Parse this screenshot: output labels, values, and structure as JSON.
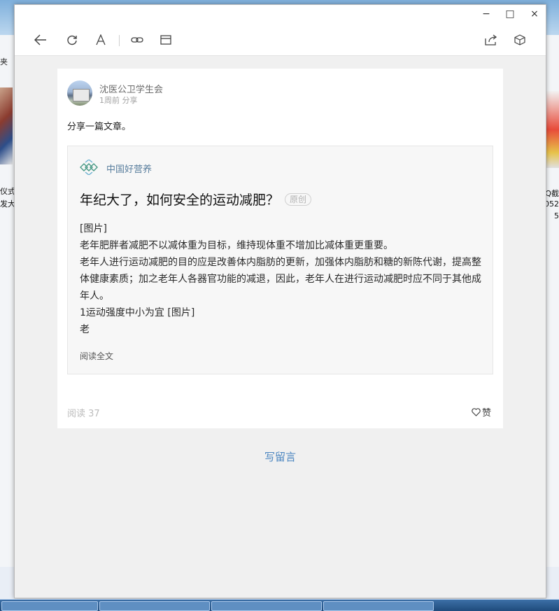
{
  "desktop": {
    "left_top_text": "夹",
    "left_label_1": "仪式",
    "left_label_2": "发大",
    "right_label_1": "QQ截",
    "right_label_2": "052",
    "right_label_3": "5"
  },
  "window": {
    "controls": {
      "minimize": "−",
      "maximize": "□",
      "close": "×"
    }
  },
  "toolbar": {
    "left_icons": [
      "back-arrow-icon",
      "refresh-icon",
      "font-size-icon",
      "link-icon",
      "window-icon"
    ],
    "right_icons": [
      "share-icon",
      "cube-icon"
    ]
  },
  "post": {
    "author": "沈医公卫学生会",
    "time": "1周前",
    "action": "分享",
    "text": "分享一篇文章。",
    "article": {
      "source": "中国好营养",
      "title": "年纪大了，如何安全的运动减肥？",
      "badge": "原创",
      "body": [
        "[图片]",
        "老年肥胖者减肥不以减体重为目标，维持现体重不增加比减体重更重要。",
        "老年人进行运动减肥的目的应是改善体内脂肪的更新，加强体内脂肪和糖的新陈代谢，提高整体健康素质；加之老年人各器官功能的减退，因此，老年人在进行运动减肥时应不同于其他成年人。",
        "1运动强度中小为宜 [图片]",
        "老"
      ],
      "read_full": "阅读全文"
    },
    "reads_label": "阅读",
    "reads_count": "37",
    "like_label": "赞"
  },
  "write_comment": "写留言"
}
